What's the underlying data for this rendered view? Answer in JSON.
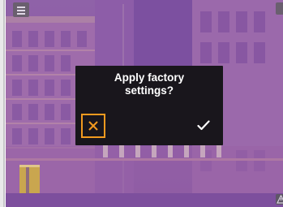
{
  "dialog": {
    "title_line1": "Apply factory",
    "title_line2": "settings?",
    "cancel_icon": "close-icon",
    "confirm_icon": "checkmark-icon"
  },
  "toolbar": {
    "menu_icon": "menu-icon",
    "status_icon": "triangle-icon"
  },
  "colors": {
    "dialog_background": "#19161c",
    "cancel_accent": "#f29a1f",
    "thermal_base": "#8e5aa6",
    "thermal_highlight": "#c9a64f"
  }
}
